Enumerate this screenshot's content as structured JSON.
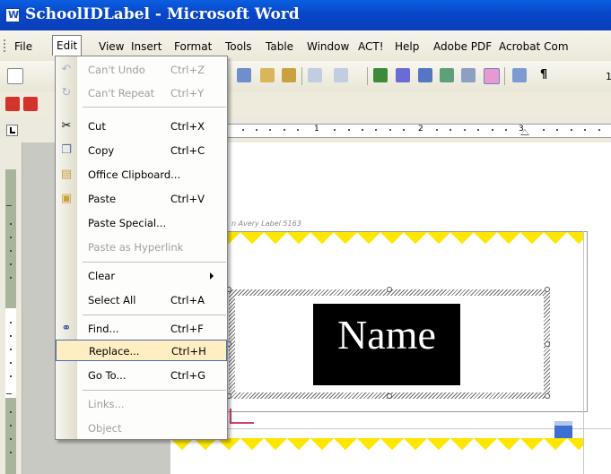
{
  "window": {
    "title": "SchoolIDLabel - Microsoft Word"
  },
  "menubar": {
    "items": [
      "File",
      "Edit",
      "View",
      "Insert",
      "Format",
      "Tools",
      "Table",
      "Window",
      "ACT!",
      "Help",
      "Adobe PDF",
      "Acrobat Com"
    ]
  },
  "toolbar": {
    "zoom_fragment": "1"
  },
  "ruler": {
    "numbers": [
      "1",
      "2",
      "3"
    ]
  },
  "edit_menu": {
    "items": [
      {
        "label": "Can't Undo",
        "shortcut": "Ctrl+Z",
        "icon": "undo-icon",
        "disabled": true
      },
      {
        "label": "Can't Repeat",
        "shortcut": "Ctrl+Y",
        "icon": "repeat-icon",
        "disabled": true
      },
      {
        "label": "Cut",
        "shortcut": "Ctrl+X",
        "icon": "scissors-icon",
        "disabled": false
      },
      {
        "label": "Copy",
        "shortcut": "Ctrl+C",
        "icon": "copy-icon",
        "disabled": false
      },
      {
        "label": "Office Clipboard...",
        "shortcut": "",
        "icon": "clipboard-icon",
        "disabled": false
      },
      {
        "label": "Paste",
        "shortcut": "Ctrl+V",
        "icon": "paste-icon",
        "disabled": false
      },
      {
        "label": "Paste Special...",
        "shortcut": "",
        "icon": "",
        "disabled": false
      },
      {
        "label": "Paste as Hyperlink",
        "shortcut": "",
        "icon": "",
        "disabled": true
      },
      {
        "label": "Clear",
        "shortcut": "",
        "icon": "",
        "disabled": false,
        "submenu": true
      },
      {
        "label": "Select All",
        "shortcut": "Ctrl+A",
        "icon": "",
        "disabled": false
      },
      {
        "label": "Find...",
        "shortcut": "Ctrl+F",
        "icon": "binoculars-icon",
        "disabled": false
      },
      {
        "label": "Replace...",
        "shortcut": "Ctrl+H",
        "icon": "",
        "disabled": false,
        "highlighted": true
      },
      {
        "label": "Go To...",
        "shortcut": "Ctrl+G",
        "icon": "",
        "disabled": false
      },
      {
        "label": "Links...",
        "shortcut": "",
        "icon": "",
        "disabled": true
      },
      {
        "label": "Object",
        "shortcut": "",
        "icon": "",
        "disabled": true
      }
    ]
  },
  "document": {
    "caption": "n Avery Label 5163",
    "name_text": "Name",
    "colors": {
      "zigzag": "#ffe600",
      "name_bg": "#000000",
      "name_fg": "#ffffff",
      "menu_highlight": "#ffeec2"
    }
  }
}
